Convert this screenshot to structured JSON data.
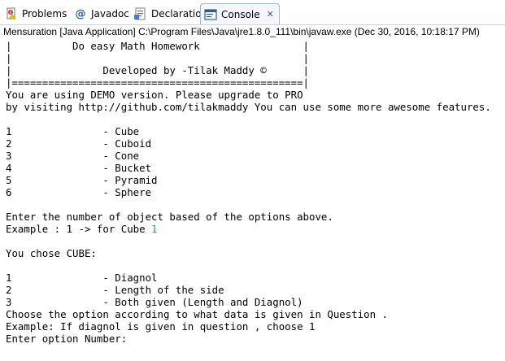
{
  "tabs": [
    {
      "label": "Problems",
      "icon": "problems-icon"
    },
    {
      "label": "Javadoc",
      "icon": "javadoc-icon"
    },
    {
      "label": "Declaration",
      "icon": "declaration-icon"
    },
    {
      "label": "Console",
      "icon": "console-icon",
      "active": true
    }
  ],
  "launch": {
    "description": "Mensuration [Java Application] C:\\Program Files\\Java\\jre1.8.0_111\\bin\\javaw.exe (Dec 30, 2016, 10:18:17 PM)"
  },
  "console": {
    "lines": [
      "|          Do easy Math Homework                 |",
      "|                                                |",
      "|               Developed by -Tilak Maddy ©      |",
      "|================================================|",
      "You are using DEMO version. Please upgrade to PRO",
      "by visiting http://github.com/tilakmaddy You can use some more awesome features.",
      "",
      "1               - Cube",
      "2               - Cuboid",
      "3               - Cone",
      "4               - Bucket",
      "5               - Pyramid",
      "6               - Sphere",
      "",
      "Enter the number of object based of the options above.",
      "Example : 1 -> for Cube ",
      "",
      "You chose CUBE:",
      "",
      "1               - Diagnol",
      "2               - Length of the side",
      "3               - Both given (Length and Diagnol)",
      "Choose the option according to what data is given in Question .",
      "Example: If diagnol is given in question , choose 1",
      "Enter option Number:"
    ],
    "user_input": "1",
    "input_color": "#1f9fa6"
  }
}
